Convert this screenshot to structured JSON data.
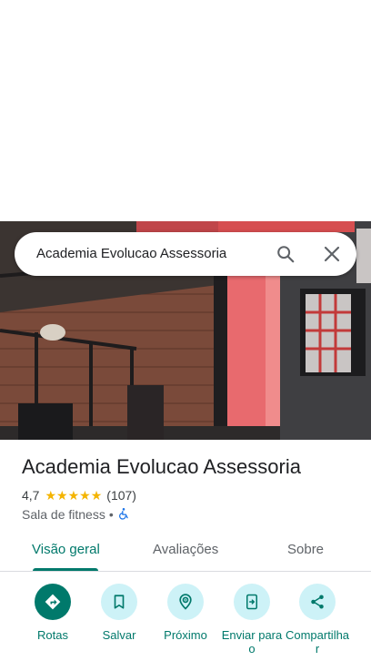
{
  "search": {
    "query": "Academia Evolucao Assessoria"
  },
  "place": {
    "name": "Academia Evolucao Assessoria",
    "rating": "4,7",
    "stars": 4.7,
    "reviews": "(107)",
    "category": "Sala de fitness",
    "separator": "•"
  },
  "tabs": [
    {
      "label": "Visão geral"
    },
    {
      "label": "Avaliações"
    },
    {
      "label": "Sobre"
    }
  ],
  "actions": [
    {
      "label": "Rotas",
      "icon": "directions-icon"
    },
    {
      "label": "Salvar",
      "icon": "bookmark-icon"
    },
    {
      "label": "Próximo",
      "icon": "nearby-icon"
    },
    {
      "label": "Enviar para o",
      "icon": "send-to-phone-icon"
    },
    {
      "label": "Compartilha r",
      "icon": "share-icon"
    }
  ],
  "colors": {
    "accent": "#00796b",
    "chip": "#cdf2f7",
    "star": "#f4b400"
  }
}
